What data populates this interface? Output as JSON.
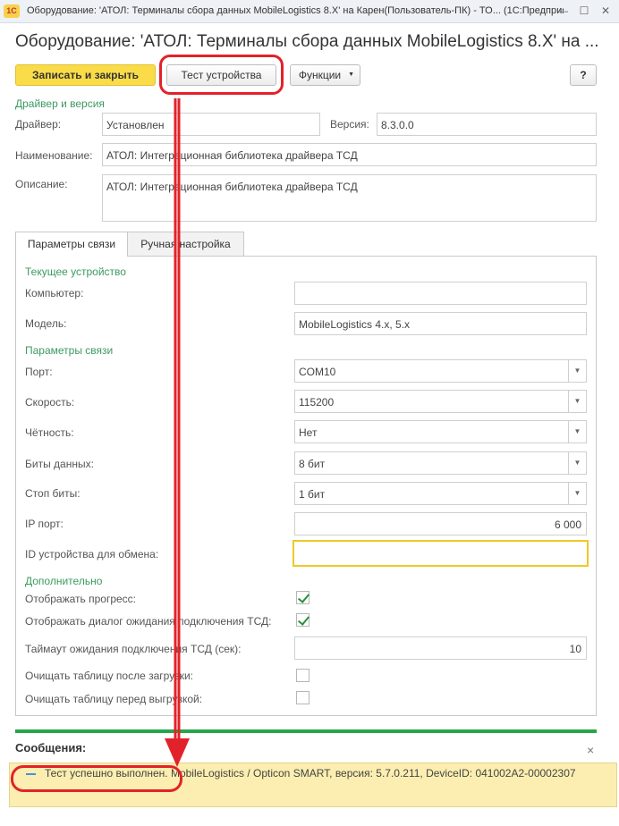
{
  "window": {
    "title": "Оборудование: 'АТОЛ: Терминалы сбора данных MobileLogistics 8.X' на Карен(Пользователь-ПК) - ТО... (1С:Предприятие)",
    "logo": "1С"
  },
  "form": {
    "title": "Оборудование: 'АТОЛ: Терминалы сбора данных MobileLogistics 8.X' на ..."
  },
  "toolbar": {
    "save_close": "Записать и закрыть",
    "test_device": "Тест устройства",
    "functions": "Функции",
    "help": "?"
  },
  "driver": {
    "section": "Драйвер и версия",
    "driver_label": "Драйвер:",
    "driver_value": "Установлен",
    "version_label": "Версия:",
    "version_value": "8.3.0.0",
    "name_label": "Наименование:",
    "name_value": "АТОЛ: Интеграционная библиотека драйвера ТСД",
    "desc_label": "Описание:",
    "desc_value": "АТОЛ: Интеграционная библиотека драйвера ТСД"
  },
  "tabs": [
    {
      "label": "Параметры связи",
      "active": true
    },
    {
      "label": "Ручная настройка",
      "active": false
    }
  ],
  "current_device": {
    "section": "Текущее устройство",
    "computer_label": "Компьютер:",
    "computer_value": "",
    "model_label": "Модель:",
    "model_value": "MobileLogistics 4.x, 5.x"
  },
  "connection": {
    "section": "Параметры связи",
    "port_label": "Порт:",
    "port_value": "COM10",
    "speed_label": "Скорость:",
    "speed_value": "115200",
    "parity_label": "Чётность:",
    "parity_value": "Нет",
    "databits_label": "Биты данных:",
    "databits_value": "8 бит",
    "stopbits_label": "Стоп биты:",
    "stopbits_value": "1 бит",
    "ipport_label": "IP порт:",
    "ipport_value": "6 000",
    "deviceid_label": "ID устройства для обмена:",
    "deviceid_value": ""
  },
  "extra": {
    "section": "Дополнительно",
    "progress_label": "Отображать прогресс:",
    "progress_checked": true,
    "dialog_label": "Отображать диалог ожидания подключения ТСД:",
    "dialog_checked": true,
    "timeout_label": "Таймаут ожидания подключения ТСД (сек):",
    "timeout_value": "10",
    "clear_after_label": "Очищать таблицу после загрузки:",
    "clear_after_checked": false,
    "clear_before_label": "Очищать таблицу перед выгрузкой:",
    "clear_before_checked": false
  },
  "messages": {
    "header": "Сообщения:",
    "close": "×",
    "text": "Тест успешно выполнен. MobileLogistics / Opticon SMART, версия: 5.7.0.211, DeviceID: 041002A2-00002307"
  },
  "colors": {
    "accent_green": "#26a64b",
    "primary_button": "#fadc48",
    "annotation_red": "#e2222a",
    "message_bg": "#fbeeb0"
  }
}
